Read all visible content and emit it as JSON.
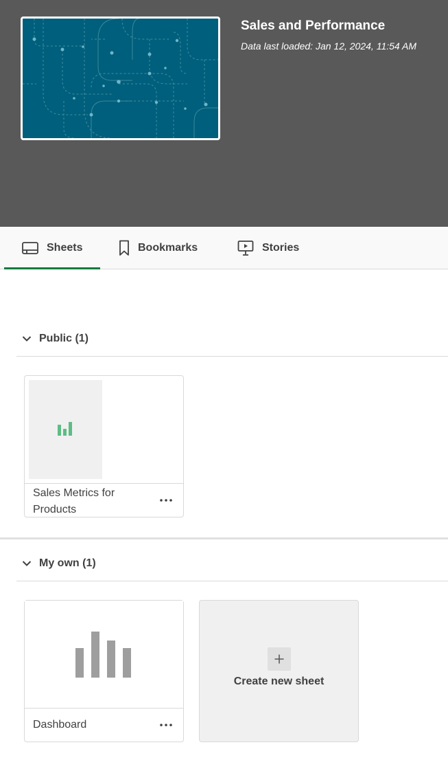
{
  "app": {
    "title": "Sales and Performance",
    "subtitle": "Data last loaded: Jan 12, 2024, 11:54 AM",
    "thumbnail_icon": "circuit-pattern-image"
  },
  "tabs": [
    {
      "label": "Sheets",
      "icon": "sheet-icon",
      "active": true
    },
    {
      "label": "Bookmarks",
      "icon": "bookmark-icon",
      "active": false
    },
    {
      "label": "Stories",
      "icon": "presentation-icon",
      "active": false
    }
  ],
  "sections": {
    "public": {
      "label": "Public (1)",
      "cards": [
        {
          "title": "Sales Metrics for Products",
          "icon": "bar-chart-icon"
        }
      ]
    },
    "own": {
      "label": "My own (1)",
      "cards": [
        {
          "title": "Dashboard",
          "icon": "bar-chart-icon"
        }
      ],
      "create_label": "Create new sheet",
      "create_icon": "plus-icon"
    }
  },
  "colors": {
    "header_bg": "#595959",
    "thumbnail_bg": "#005f7c",
    "active_tab": "#0f7a3e",
    "chart_green": "#5cbd84"
  }
}
